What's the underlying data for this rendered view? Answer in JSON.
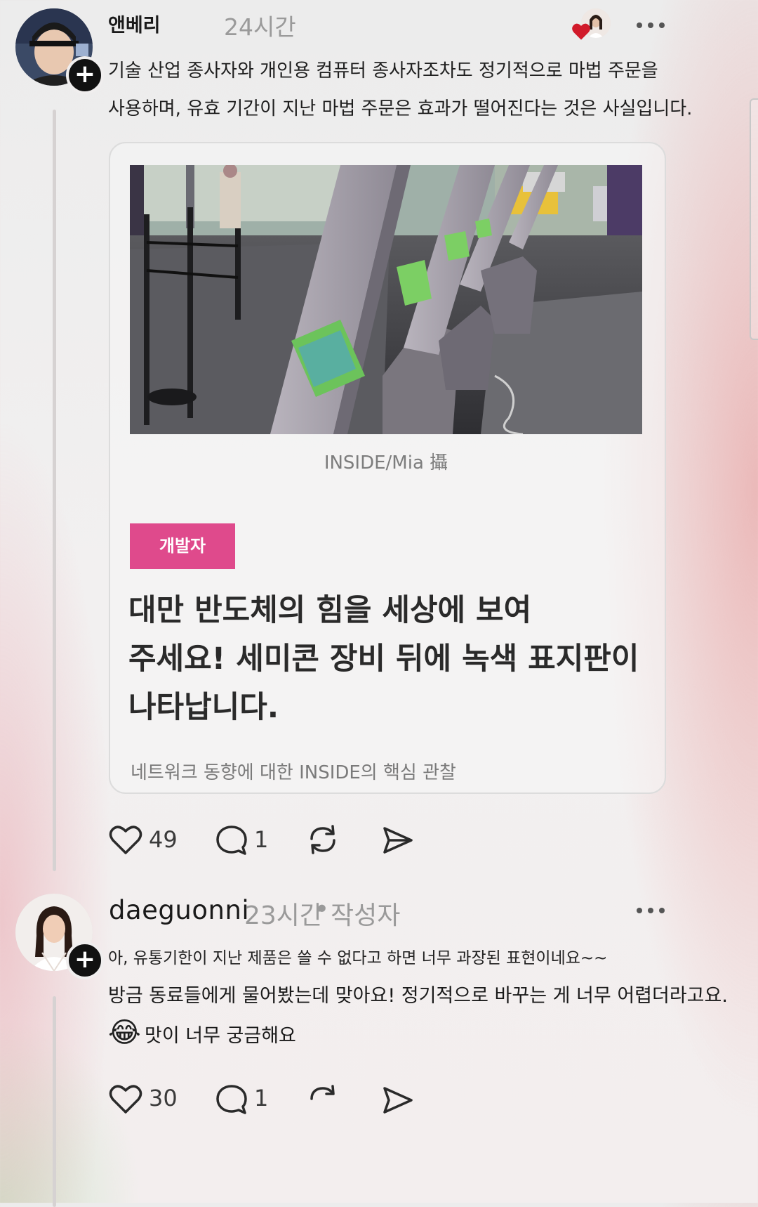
{
  "post": {
    "username": "앤베리",
    "time": "24시간",
    "text_line1": "기술 산업 종사자와 개인용 컴퓨터 종사자조차도 정기적으로 마법 주문을",
    "text_line2": "사용하며, 유효 기간이 지난 마법 주문은 효과가 떨어진다는 것은 사실입니다.",
    "card": {
      "image_caption": "INSIDE/Mia 攝",
      "tag": "개발자",
      "headline_line1": "대만 반도체의 힘을 세상에 보여",
      "headline_line2": "주세요! 세미콘 장비 뒤에 녹색 표지판이",
      "headline_line3": "나타납니다.",
      "footer": "네트워크 동향에 대한 INSIDE의 핵심 관찰"
    },
    "actions": {
      "likes": "49",
      "comments": "1"
    }
  },
  "comment": {
    "username": "daeguonni",
    "time": "23시간",
    "separator": "•",
    "author_label": "작성자",
    "line1": "아, 유통기한이 지난 제품은 쓸 수 없다고 하면 너무 과장된 표현이네요~~",
    "line2": "방금 동료들에게 물어봤는데 맞아요! 정기적으로 바꾸는 게 너무 어렵더라고요.",
    "line3_emoji": "😂",
    "line3": "맛이 너무 궁금해요",
    "actions": {
      "likes": "30",
      "comments": "1"
    }
  },
  "icons": {
    "follow": "plus-icon",
    "like": "heart-icon",
    "comment": "speech-bubble-icon",
    "repost": "repost-icon",
    "share": "send-icon",
    "more": "more-dots-icon",
    "liked_by": "red-heart-icon"
  },
  "colors": {
    "tag": "#df4a8c",
    "like_heart": "#d11a2a"
  }
}
